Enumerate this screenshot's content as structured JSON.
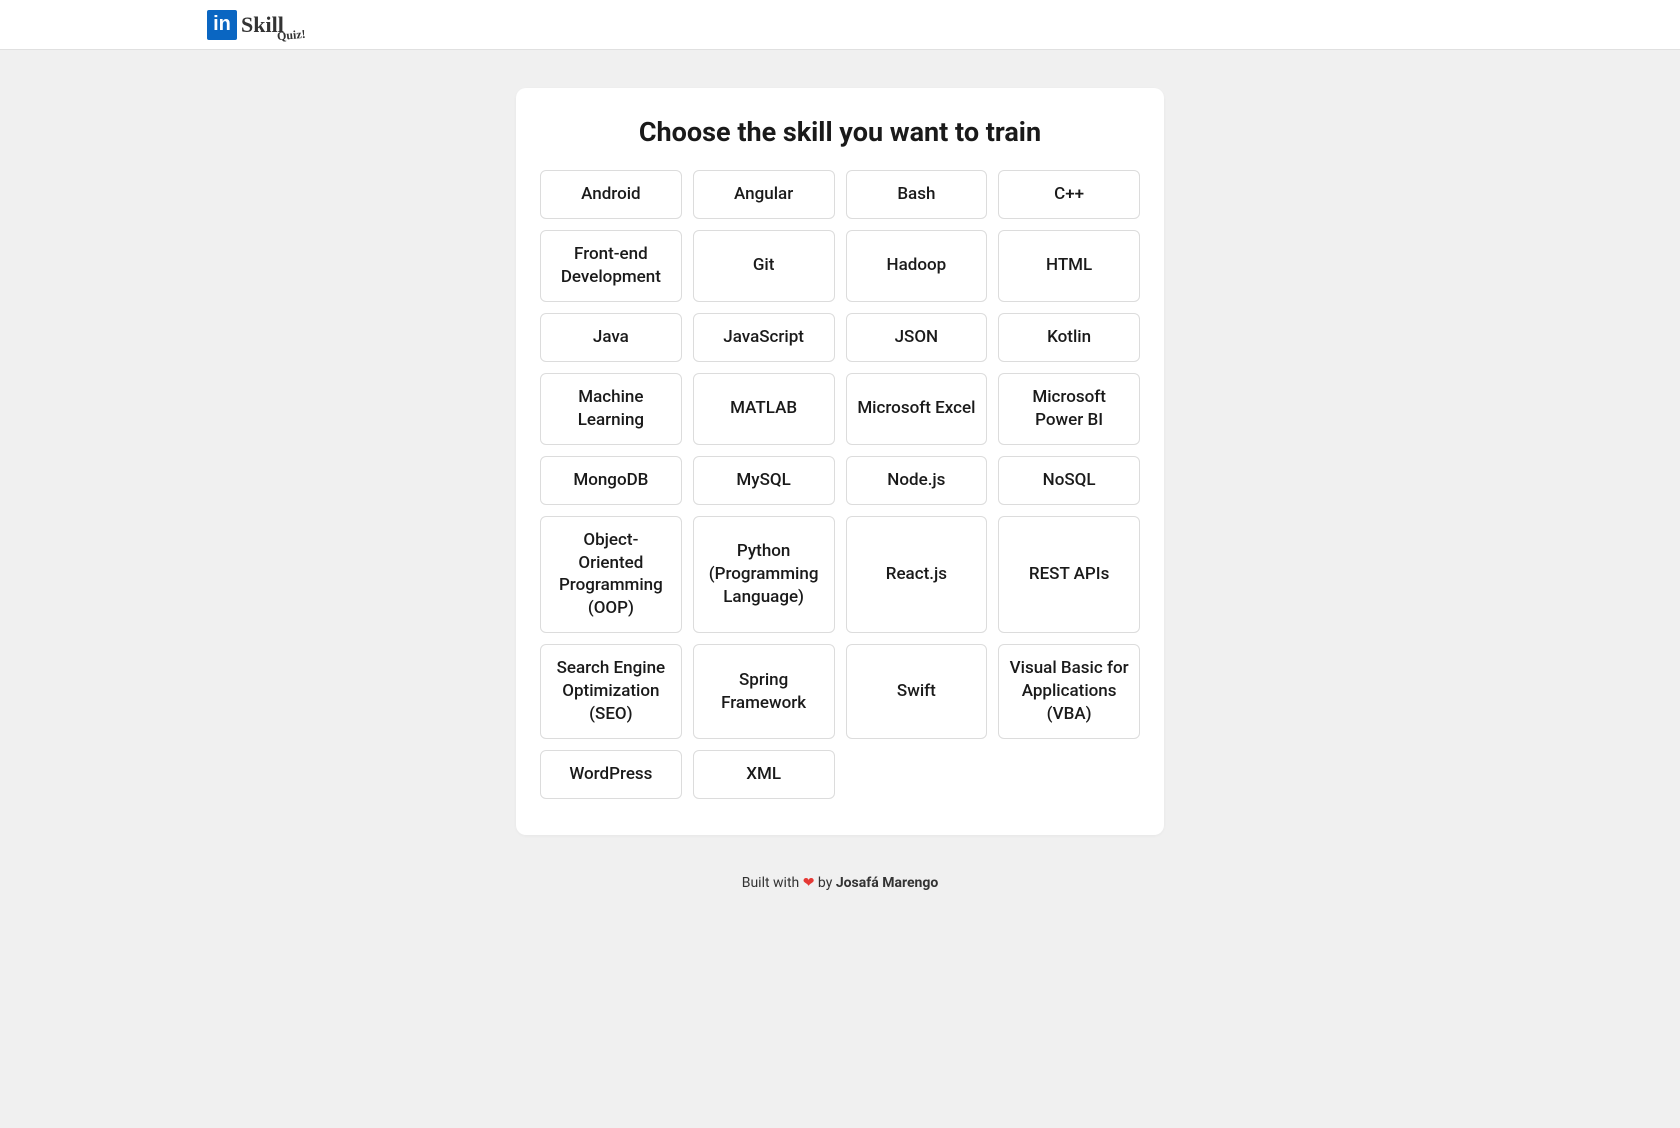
{
  "logo": {
    "in": "in",
    "skill": "Skill",
    "quiz": "Quiz!"
  },
  "main": {
    "title": "Choose the skill you want to train",
    "skills": [
      "Android",
      "Angular",
      "Bash",
      "C++",
      "Front-end Development",
      "Git",
      "Hadoop",
      "HTML",
      "Java",
      "JavaScript",
      "JSON",
      "Kotlin",
      "Machine Learning",
      "MATLAB",
      "Microsoft Excel",
      "Microsoft Power BI",
      "MongoDB",
      "MySQL",
      "Node.js",
      "NoSQL",
      "Object-Oriented Programming (OOP)",
      "Python (Programming Language)",
      "React.js",
      "REST APIs",
      "Search Engine Optimization (SEO)",
      "Spring Framework",
      "Swift",
      "Visual Basic for Applications (VBA)",
      "WordPress",
      "XML"
    ]
  },
  "footer": {
    "prefix": "Built with ",
    "heart": "❤",
    "middle": " by  ",
    "author": "Josafá Marengo"
  }
}
